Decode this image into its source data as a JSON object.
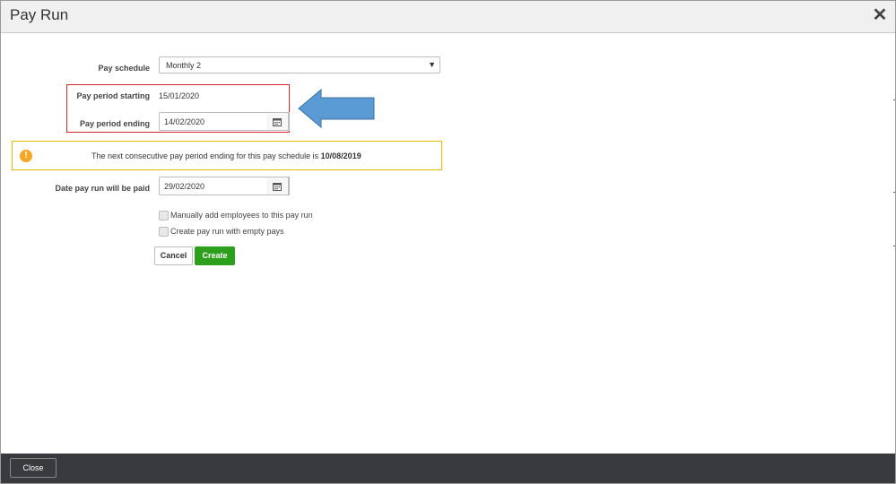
{
  "dialog": {
    "title": "Pay Run",
    "close_icon": "close-icon"
  },
  "form": {
    "pay_schedule": {
      "label": "Pay schedule",
      "value": "Monthly 2"
    },
    "pay_period_starting": {
      "label": "Pay period starting",
      "value": "15/01/2020"
    },
    "pay_period_ending": {
      "label": "Pay period ending",
      "value": "14/02/2020"
    },
    "warning": {
      "text": "The next consecutive pay period ending for this pay schedule is ",
      "date": "10/08/2019"
    },
    "date_paid": {
      "label": "Date pay run will be paid",
      "value": "29/02/2020"
    },
    "checkboxes": [
      {
        "label": "Manually add employees to this pay run",
        "checked": false
      },
      {
        "label": "Create pay run with empty pays",
        "checked": false
      }
    ],
    "cancel_label": "Cancel",
    "create_label": "Create"
  },
  "footer": {
    "close_label": "Close"
  },
  "colors": {
    "accent_green": "#2ca01c",
    "highlight_red": "#d9262e",
    "warning_border": "#e6b800",
    "warning_icon": "#f5a623",
    "annotation_arrow": "#5b9bd5",
    "footer_bg": "#393a3d"
  }
}
